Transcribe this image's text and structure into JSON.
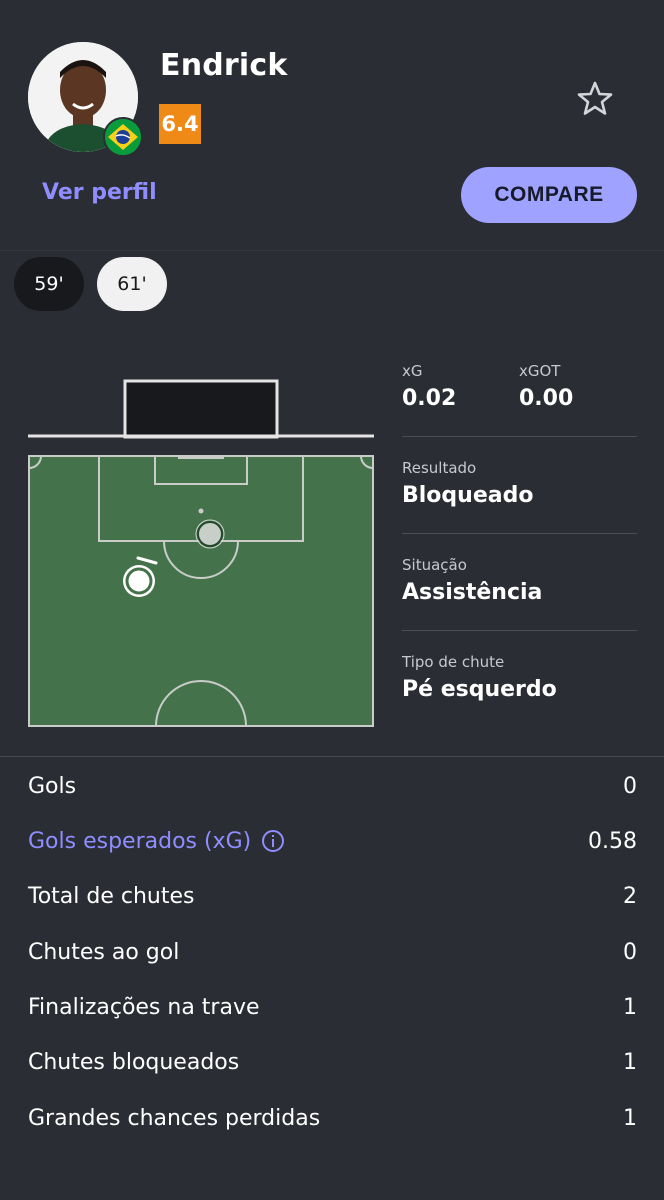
{
  "player": {
    "name": "Endrick",
    "rating": "6.4",
    "flag_icon": "brazil-flag-icon"
  },
  "actions": {
    "profile_link": "Ver perfil",
    "compare_button": "COMPARE",
    "favorite_icon": "star-outline-icon"
  },
  "shot_tabs": [
    {
      "label": "59'",
      "selected": false
    },
    {
      "label": "61'",
      "selected": true
    }
  ],
  "shot_info": {
    "xg": {
      "label": "xG",
      "value": "0.02"
    },
    "xgot": {
      "label": "xGOT",
      "value": "0.00"
    },
    "result": {
      "label": "Resultado",
      "value": "Bloqueado"
    },
    "situation": {
      "label": "Situação",
      "value": "Assistência"
    },
    "shot_type": {
      "label": "Tipo de chute",
      "value": "Pé esquerdo"
    }
  },
  "stats": [
    {
      "label": "Gols",
      "value": "0",
      "accent": false
    },
    {
      "label": "Gols esperados (xG)",
      "value": "0.58",
      "accent": true
    },
    {
      "label": "Total de chutes",
      "value": "2",
      "accent": false
    },
    {
      "label": "Chutes ao gol",
      "value": "0",
      "accent": false
    },
    {
      "label": "Finalizações na trave",
      "value": "1",
      "accent": false
    },
    {
      "label": "Chutes bloqueados",
      "value": "1",
      "accent": false
    },
    {
      "label": "Grandes chances perdidas",
      "value": "1",
      "accent": false
    }
  ],
  "colors": {
    "background": "#2a2d33",
    "accent": "#8f8dff",
    "rating": "#f08a16",
    "pitch": "#44724a"
  }
}
